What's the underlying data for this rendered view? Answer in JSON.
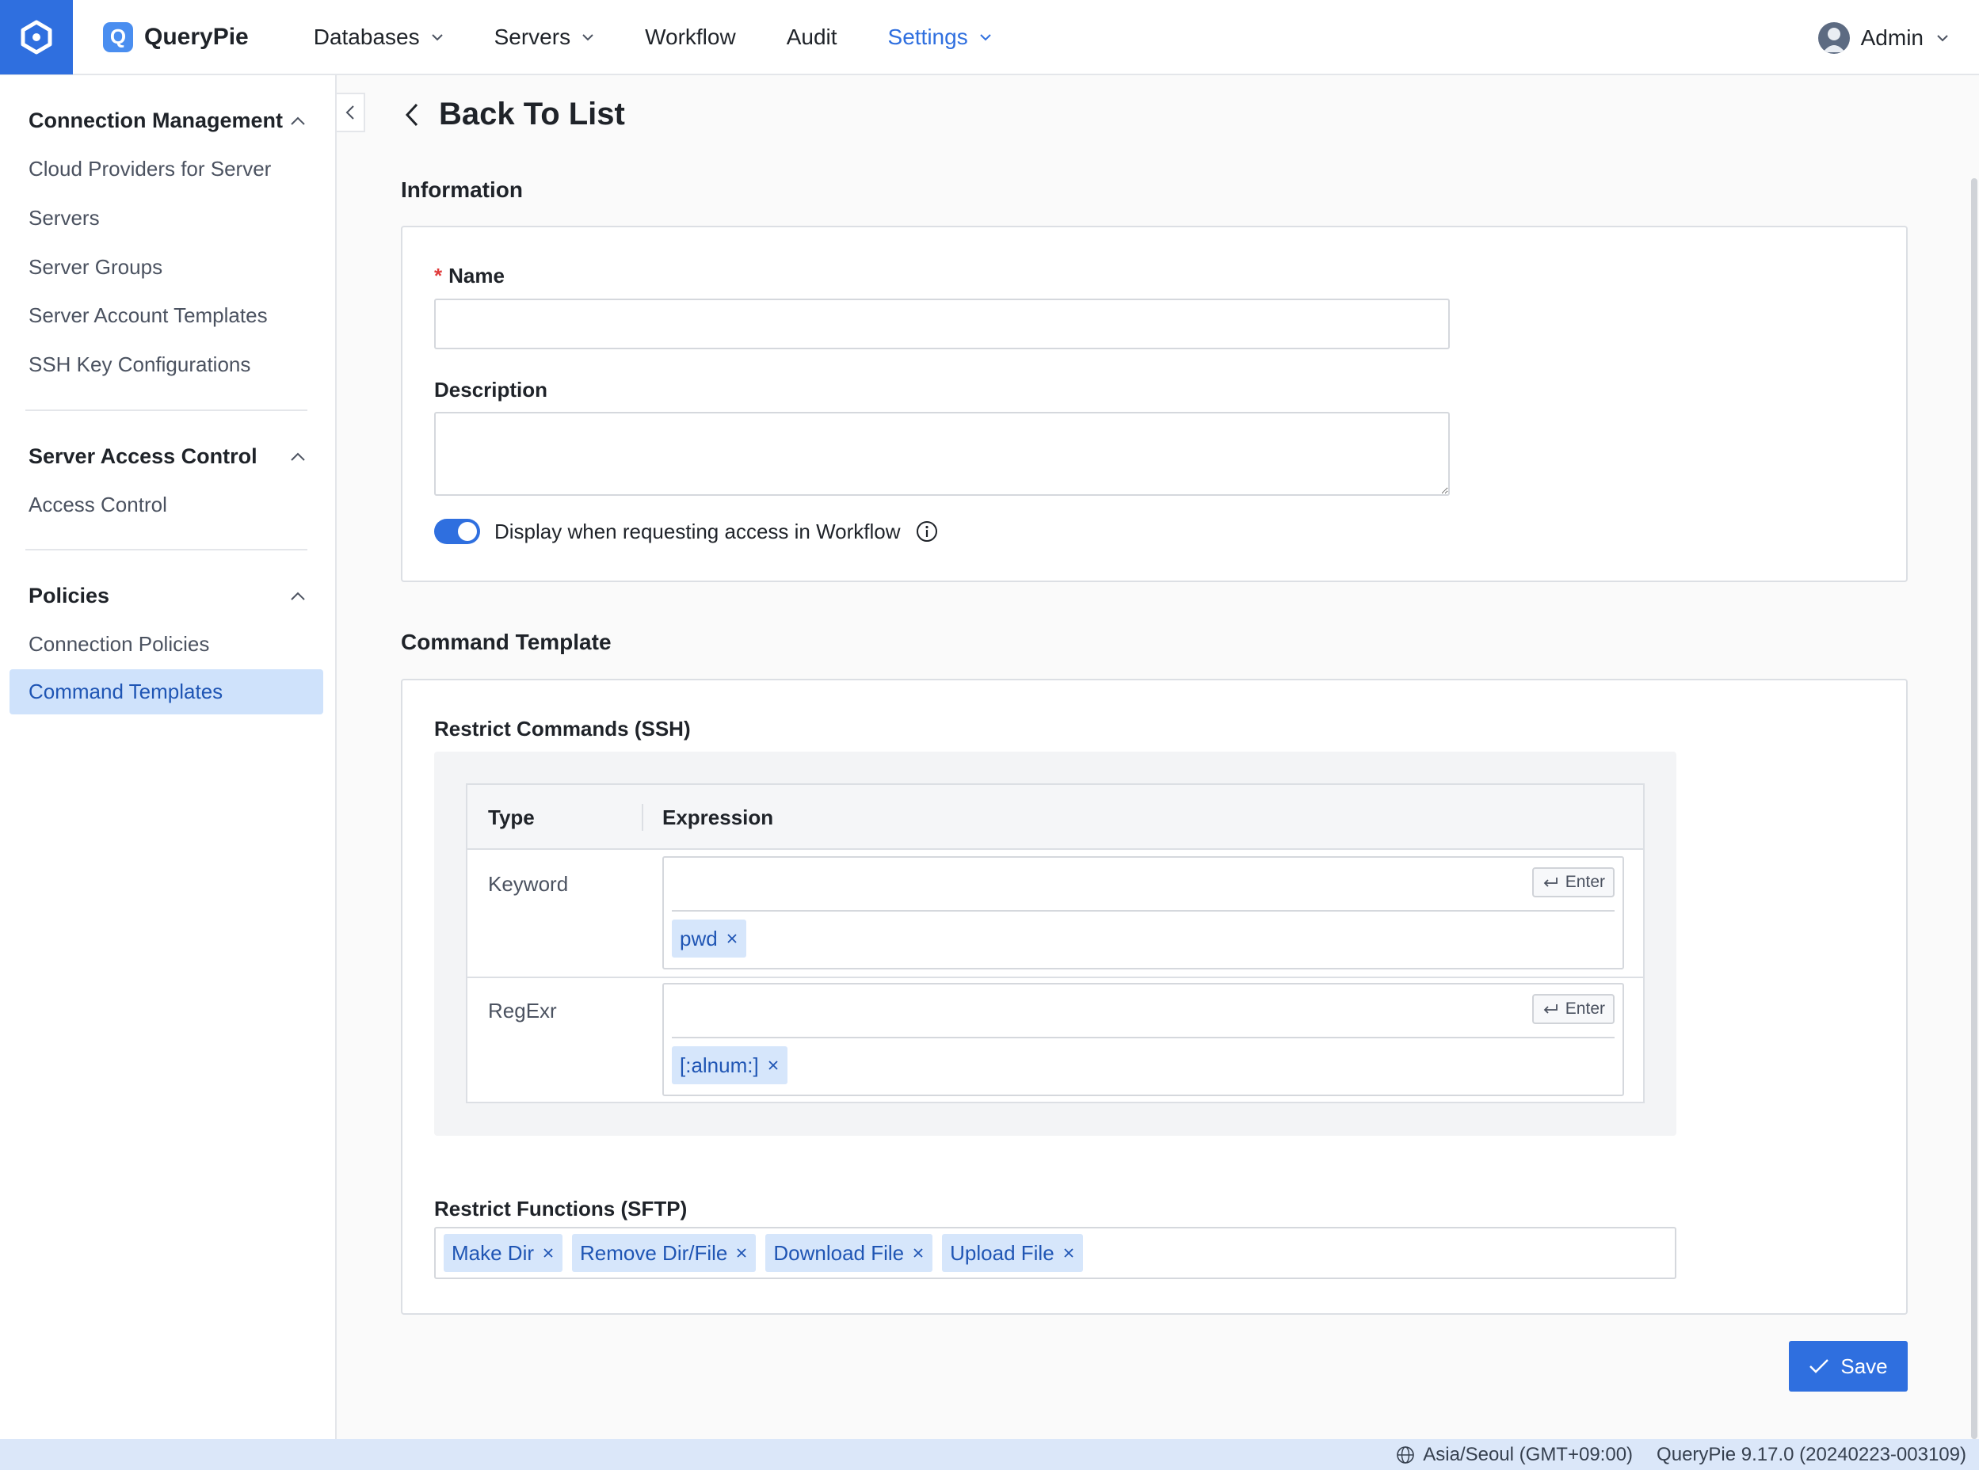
{
  "brand": {
    "logo_letter": "Q",
    "name": "QueryPie",
    "accent": "#2f6fdf"
  },
  "nav": {
    "items": [
      {
        "label": "Databases",
        "dropdown": true
      },
      {
        "label": "Servers",
        "dropdown": true
      },
      {
        "label": "Workflow",
        "dropdown": false
      },
      {
        "label": "Audit",
        "dropdown": false
      },
      {
        "label": "Settings",
        "dropdown": true,
        "active": true
      }
    ],
    "user": {
      "label": "Admin",
      "icon": "avatar-icon"
    }
  },
  "sidebar": {
    "sections": [
      {
        "title": "Connection Management",
        "items": [
          "Cloud Providers for Server",
          "Servers",
          "Server Groups",
          "Server Account Templates",
          "SSH Key Configurations"
        ]
      },
      {
        "title": "Server Access Control",
        "items": [
          "Access Control"
        ]
      },
      {
        "title": "Policies",
        "items": [
          "Connection Policies",
          "Command Templates"
        ],
        "selected": "Command Templates"
      }
    ]
  },
  "page": {
    "back_label": "Back To List",
    "information_title": "Information",
    "name_label": "Name",
    "name_value": "",
    "description_label": "Description",
    "description_value": "",
    "toggle_label": "Display when requesting access in Workflow",
    "toggle_on": true,
    "command_template_title": "Command Template",
    "restrict_commands_label": "Restrict Commands (SSH)",
    "table_headers": {
      "type": "Type",
      "expression": "Expression"
    },
    "rows": [
      {
        "type": "Keyword",
        "input": "",
        "enter_label": "Enter",
        "tags": [
          "pwd"
        ]
      },
      {
        "type": "RegExr",
        "input": "",
        "enter_label": "Enter",
        "tags": [
          "[:alnum:]"
        ]
      }
    ],
    "restrict_functions_label": "Restrict Functions (SFTP)",
    "sftp_tags": [
      "Make Dir",
      "Remove Dir/File",
      "Download File",
      "Upload File"
    ],
    "save_label": "Save"
  },
  "footer": {
    "timezone": "Asia/Seoul (GMT+09:00)",
    "version": "QueryPie 9.17.0 (20240223-003109)"
  }
}
